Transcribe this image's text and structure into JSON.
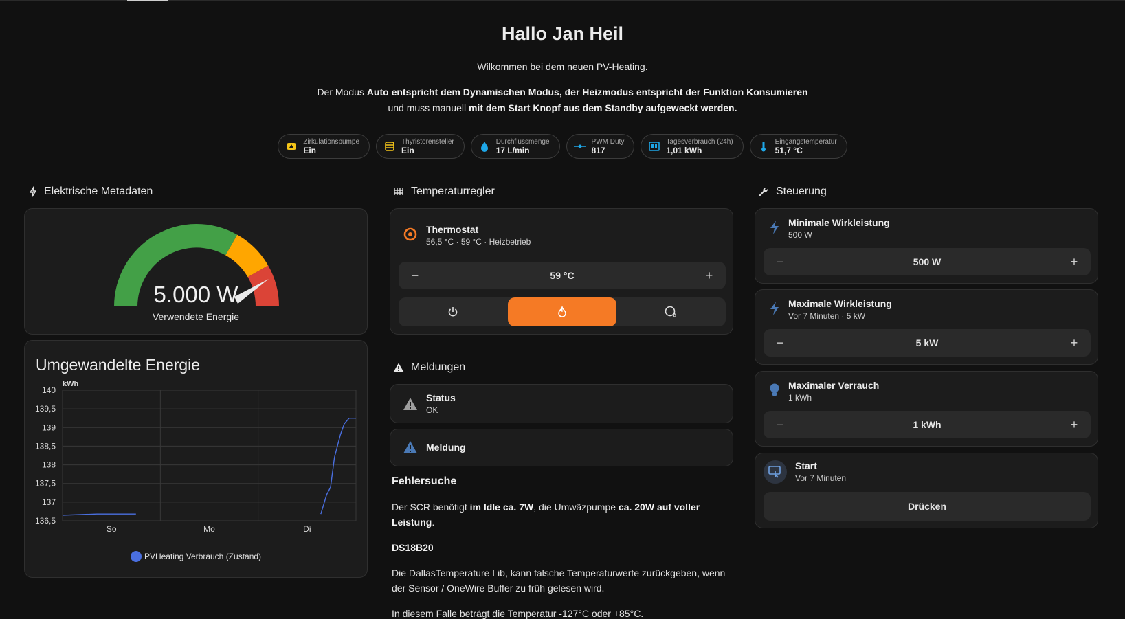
{
  "header": {
    "greeting": "Hallo Jan Heil",
    "welcome": "Wilkommen bei dem neuen PV-Heating.",
    "mode_text": {
      "t1": "Der Modus ",
      "b1": "Auto entspricht dem Dynamischen Modus, der Heizmodus entspricht der Funktion Konsumieren",
      "t2": "und muss manuell ",
      "b2": "mit dem Start Knopf aus dem Standby aufgeweckt werden."
    }
  },
  "chips": [
    {
      "label": "Zirkulationspumpe",
      "value": "Ein",
      "icon": "pump-icon",
      "color": "#f5c518"
    },
    {
      "label": "Thyristorensteller",
      "value": "Ein",
      "icon": "heater-icon",
      "color": "#f5c518"
    },
    {
      "label": "Durchflussmenge",
      "value": "17 L/min",
      "icon": "water-drop-icon",
      "color": "#1ea7e8"
    },
    {
      "label": "PWM Duty",
      "value": "817",
      "icon": "pwm-icon",
      "color": "#1ea7e8"
    },
    {
      "label": "Tagesverbrauch (24h)",
      "value": "1,01 kWh",
      "icon": "meter-icon",
      "color": "#1ea7e8"
    },
    {
      "label": "Eingangstemperatur",
      "value": "51,7 °C",
      "icon": "thermometer-icon",
      "color": "#1ea7e8"
    }
  ],
  "left": {
    "title": "Elektrische Metadaten",
    "gauge": {
      "value": "5.000 W",
      "label": "Verwendete Energie",
      "fraction": 0.86,
      "segments": [
        "#43a047",
        "#ffa600",
        "#db4437"
      ]
    },
    "chart_card_title": "Umgewandelte Energie"
  },
  "chart_data": {
    "type": "line",
    "title": "Umgewandelte Energie",
    "ylabel": "kWh",
    "ylim": [
      136.5,
      140
    ],
    "yticks": [
      "140",
      "139,5",
      "139",
      "138,5",
      "138",
      "137,5",
      "137",
      "136,5"
    ],
    "xticks": [
      "So",
      "Mo",
      "Di"
    ],
    "legend": "PVHeating Verbrauch (Zustand)",
    "series": [
      {
        "name": "PVHeating Verbrauch (Zustand)",
        "color": "#4a6fe0",
        "segments": [
          [
            [
              0.0,
              136.65
            ],
            [
              0.35,
              136.68
            ],
            [
              0.75,
              136.68
            ]
          ],
          [
            [
              2.64,
              136.68
            ],
            [
              2.7,
              137.2
            ],
            [
              2.74,
              137.4
            ],
            [
              2.78,
              138.2
            ],
            [
              2.84,
              138.8
            ],
            [
              2.88,
              139.1
            ],
            [
              2.93,
              139.25
            ],
            [
              3.0,
              139.25
            ]
          ]
        ]
      }
    ]
  },
  "middle": {
    "title": "Temperaturregler",
    "thermostat": {
      "name": "Thermostat",
      "status": "56,5 °C · 59 °C · Heizbetrieb",
      "target": "59 °C",
      "minus": "−",
      "plus": "+"
    },
    "messages_title": "Meldungen",
    "status": {
      "name": "Status",
      "value": "OK"
    },
    "message": {
      "name": "Meldung"
    },
    "troubleshoot": {
      "title": "Fehlersuche",
      "p1": {
        "t1": "Der SCR benötigt ",
        "b1": "im Idle ca. 7W",
        "t2": ", die Umwäzpumpe ",
        "b2": "ca. 20W auf voller Leistung",
        "t3": "."
      },
      "h2": "DS18B20",
      "p2": "Die DallasTemperature Lib, kann falsche Temperaturwerte zurückgeben, wenn der Sensor / OneWire Buffer zu früh gelesen wird.",
      "p3": "In diesem Falle beträgt die Temperatur -127°C oder +85°C."
    }
  },
  "right": {
    "title": "Steuerung",
    "controls": [
      {
        "name": "Minimale Wirkleistung",
        "sub": "500 W",
        "value": "500 W"
      },
      {
        "name": "Maximale Wirkleistung",
        "sub": "Vor 7 Minuten · 5 kW",
        "value": "5 kW"
      },
      {
        "name": "Maximaler Verrauch",
        "sub": "1 kWh",
        "value": "1 kWh"
      }
    ],
    "start": {
      "name": "Start",
      "sub": "Vor 7 Minuten",
      "button": "Drücken"
    }
  },
  "colors": {
    "accent": "#f57a25",
    "icon_blue": "#4a79b5",
    "chip_yellow": "#f5c518",
    "chip_blue": "#1ea7e8"
  }
}
